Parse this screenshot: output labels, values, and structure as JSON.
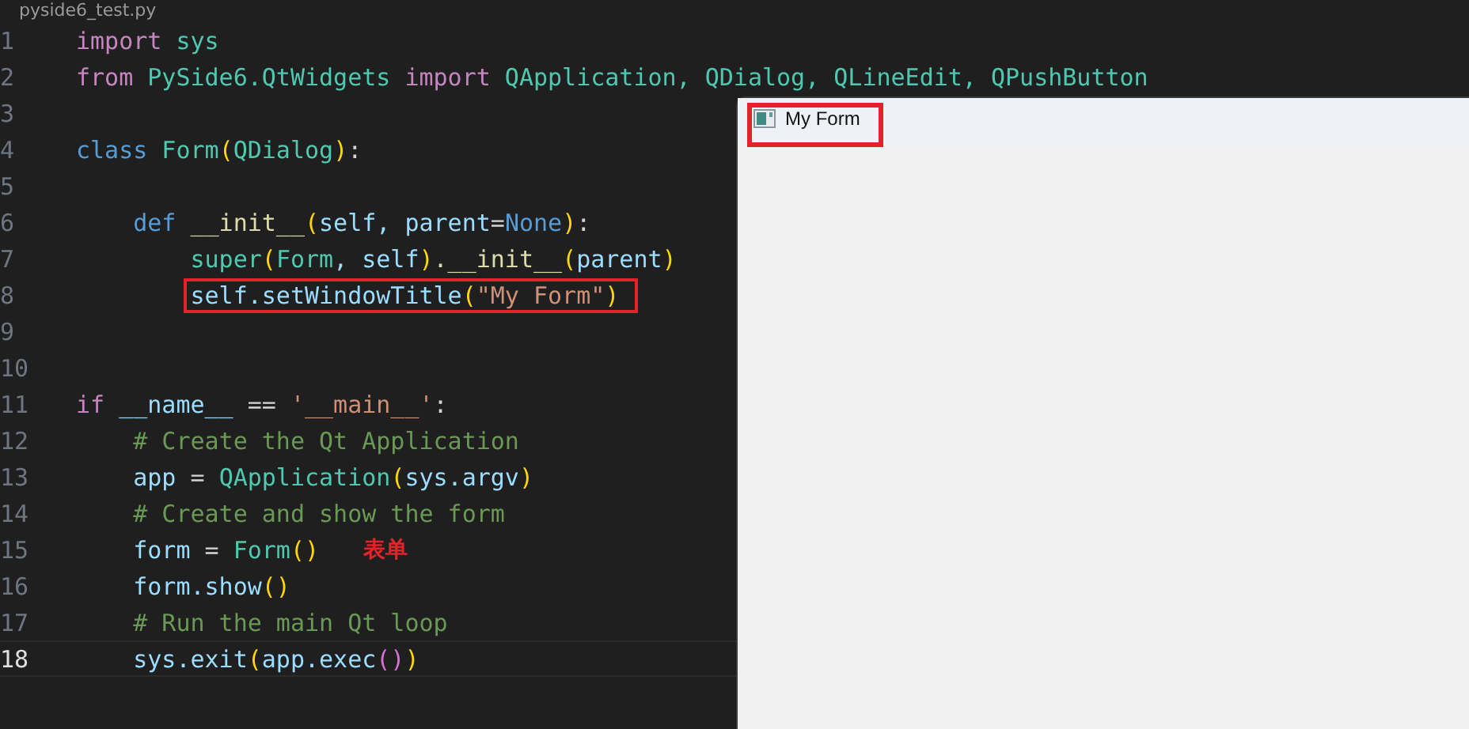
{
  "editor": {
    "file_tab": "pyside6_test.py",
    "lines": [
      {
        "number": "1",
        "current": false,
        "highlighted": false,
        "tokens": [
          {
            "text": "import",
            "kind": "kw"
          },
          {
            "text": " sys",
            "kind": "mod"
          }
        ]
      },
      {
        "number": "2",
        "current": false,
        "highlighted": false,
        "tokens": [
          {
            "text": "from",
            "kind": "kw"
          },
          {
            "text": " PySide6.QtWidgets ",
            "kind": "cls"
          },
          {
            "text": "import",
            "kind": "kw"
          },
          {
            "text": " QApplication, QDialog, QLineEdit, QPushButton",
            "kind": "cls"
          }
        ]
      },
      {
        "number": "3",
        "current": false,
        "highlighted": false
      },
      {
        "number": "4",
        "current": false,
        "highlighted": false,
        "tokens": [
          {
            "text": "class",
            "kind": "kw2"
          },
          {
            "text": " Form",
            "kind": "cls"
          },
          {
            "text": "(",
            "kind": "paren"
          },
          {
            "text": "QDialog",
            "kind": "cls"
          },
          {
            "text": ")",
            "kind": "paren"
          },
          {
            "text": ":",
            "kind": "plain"
          }
        ]
      },
      {
        "number": "5",
        "current": false,
        "highlighted": false
      },
      {
        "number": "6",
        "current": false,
        "highlighted": false,
        "tokens": [
          {
            "text": "    def",
            "kind": "kw2"
          },
          {
            "text": " __init__",
            "kind": "fn"
          },
          {
            "text": "(",
            "kind": "paren"
          },
          {
            "text": "self, parent",
            "kind": "var"
          },
          {
            "text": "=",
            "kind": "plain"
          },
          {
            "text": "None",
            "kind": "kw2"
          },
          {
            "text": ")",
            "kind": "paren"
          },
          {
            "text": ":",
            "kind": "plain"
          }
        ]
      },
      {
        "number": "7",
        "current": false,
        "highlighted": false,
        "tokens": [
          {
            "text": "        super",
            "kind": "cls"
          },
          {
            "text": "(",
            "kind": "paren"
          },
          {
            "text": "Form",
            "kind": "cls"
          },
          {
            "text": ", self",
            "kind": "var"
          },
          {
            "text": ")",
            "kind": "paren"
          },
          {
            "text": ".__init__",
            "kind": "fn"
          },
          {
            "text": "(",
            "kind": "paren"
          },
          {
            "text": "parent",
            "kind": "var"
          },
          {
            "text": ")",
            "kind": "paren"
          }
        ]
      },
      {
        "number": "8",
        "current": false,
        "highlighted": true,
        "tokens": [
          {
            "text": "        self.setWindowTitle",
            "kind": "var"
          },
          {
            "text": "(",
            "kind": "paren"
          },
          {
            "text": "\"My Form\"",
            "kind": "str"
          },
          {
            "text": ")",
            "kind": "paren"
          }
        ]
      },
      {
        "number": "9",
        "current": false,
        "highlighted": false
      },
      {
        "number": "10",
        "current": false,
        "highlighted": false
      },
      {
        "number": "11",
        "current": false,
        "highlighted": false,
        "tokens": [
          {
            "text": "if",
            "kind": "kw"
          },
          {
            "text": " __name__ ",
            "kind": "var"
          },
          {
            "text": "==",
            "kind": "plain"
          },
          {
            "text": " '__main__'",
            "kind": "str"
          },
          {
            "text": ":",
            "kind": "plain"
          }
        ]
      },
      {
        "number": "12",
        "current": false,
        "highlighted": false,
        "tokens": [
          {
            "text": "    # Create the Qt Application",
            "kind": "cmt"
          }
        ]
      },
      {
        "number": "13",
        "current": false,
        "highlighted": false,
        "tokens": [
          {
            "text": "    app ",
            "kind": "var"
          },
          {
            "text": "= ",
            "kind": "plain"
          },
          {
            "text": "QApplication",
            "kind": "cls"
          },
          {
            "text": "(",
            "kind": "paren"
          },
          {
            "text": "sys.argv",
            "kind": "var"
          },
          {
            "text": ")",
            "kind": "paren"
          }
        ]
      },
      {
        "number": "14",
        "current": false,
        "highlighted": false,
        "tokens": [
          {
            "text": "    # Create and show the form",
            "kind": "cmt"
          }
        ]
      },
      {
        "number": "15",
        "current": false,
        "highlighted": false,
        "note": "表单",
        "tokens": [
          {
            "text": "    form ",
            "kind": "var"
          },
          {
            "text": "= ",
            "kind": "plain"
          },
          {
            "text": "Form",
            "kind": "cls"
          },
          {
            "text": "()",
            "kind": "paren"
          }
        ]
      },
      {
        "number": "16",
        "current": false,
        "highlighted": false,
        "tokens": [
          {
            "text": "    form.show",
            "kind": "var"
          },
          {
            "text": "()",
            "kind": "paren"
          }
        ]
      },
      {
        "number": "17",
        "current": false,
        "highlighted": false,
        "tokens": [
          {
            "text": "    # Run the main Qt loop",
            "kind": "cmt"
          }
        ]
      },
      {
        "number": "18",
        "current": true,
        "highlighted": false,
        "tokens": [
          {
            "text": "    sys.exit",
            "kind": "var"
          },
          {
            "text": "(",
            "kind": "paren"
          },
          {
            "text": "app.exec",
            "kind": "var"
          },
          {
            "text": "()",
            "kind": "paren2"
          },
          {
            "text": ")",
            "kind": "paren"
          }
        ]
      }
    ]
  },
  "dialog": {
    "title": "My Form",
    "title_highlighted": true
  }
}
